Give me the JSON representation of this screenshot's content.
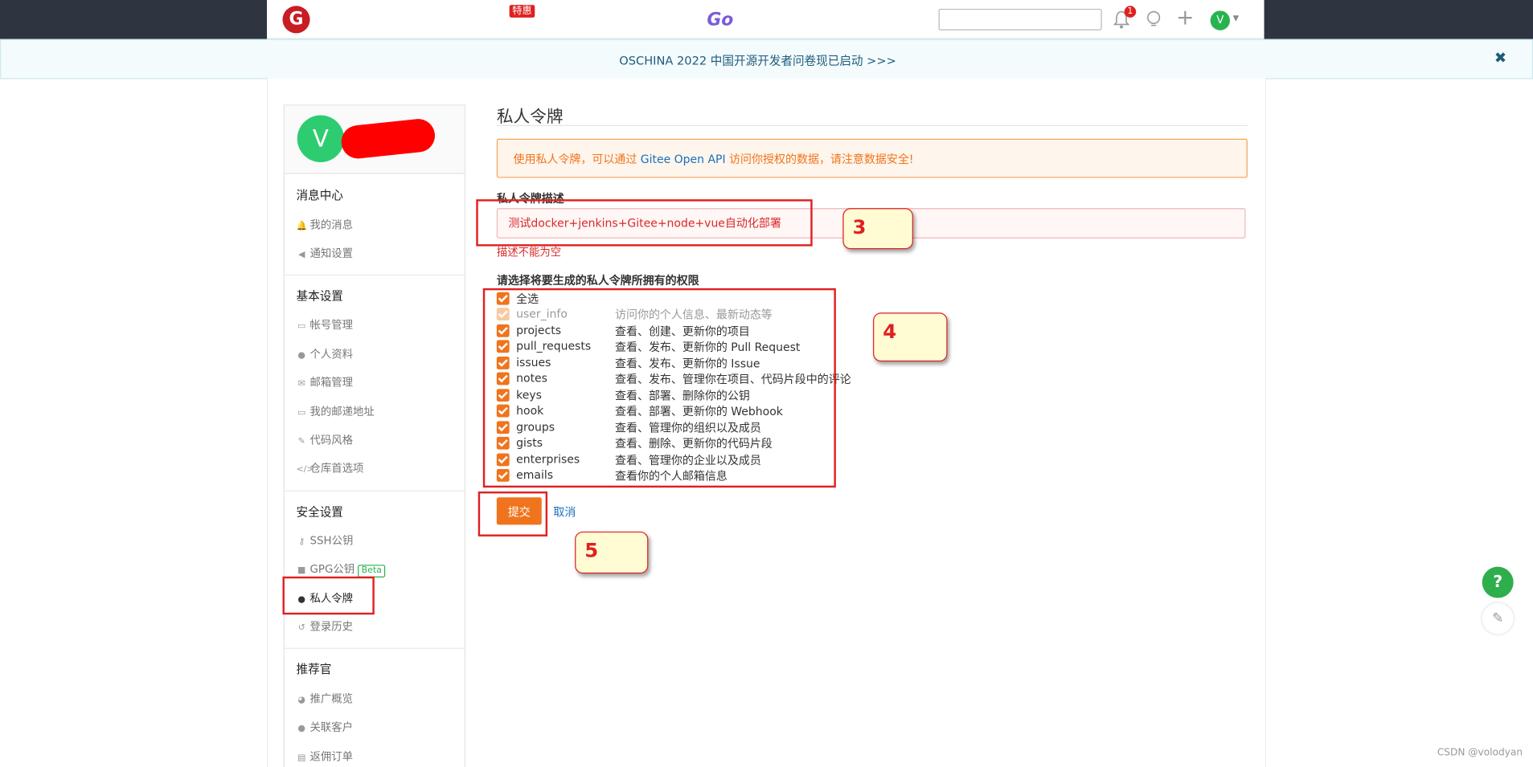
{
  "navbar": {
    "logo": "G",
    "promo_badge": "特惠",
    "go_label": "Go",
    "notification_count": "1",
    "avatar_letter": "V"
  },
  "notice": {
    "text": "OSCHINA 2022 中国开源开发者问卷现已启动 >>>",
    "close": "✖"
  },
  "sidebar": {
    "avatar_letter": "V",
    "groups": [
      {
        "title": "消息中心",
        "items": [
          {
            "icon": "bell-icon",
            "label": "我的消息"
          },
          {
            "icon": "speaker-icon",
            "label": "通知设置"
          }
        ]
      },
      {
        "title": "基本设置",
        "items": [
          {
            "icon": "idcard-icon",
            "label": "帐号管理"
          },
          {
            "icon": "user-icon",
            "label": "个人资料"
          },
          {
            "icon": "mail-icon",
            "label": "邮箱管理"
          },
          {
            "icon": "address-icon",
            "label": "我的邮递地址"
          },
          {
            "icon": "brush-icon",
            "label": "代码风格"
          },
          {
            "icon": "code-icon",
            "label": "仓库首选项"
          }
        ]
      },
      {
        "title": "安全设置",
        "items": [
          {
            "icon": "key-icon",
            "label": "SSH公钥"
          },
          {
            "icon": "lock-icon",
            "label": "GPG公钥",
            "badge": "Beta"
          },
          {
            "icon": "user-secret-icon",
            "label": "私人令牌",
            "active": true
          },
          {
            "icon": "history-icon",
            "label": "登录历史"
          }
        ]
      },
      {
        "title": "推荐官",
        "items": [
          {
            "icon": "chart-icon",
            "label": "推广概览"
          },
          {
            "icon": "users-icon",
            "label": "关联客户"
          },
          {
            "icon": "order-icon",
            "label": "返佣订单"
          }
        ]
      }
    ]
  },
  "main": {
    "title": "私人令牌",
    "alert": {
      "prefix": "使用私人令牌，可以通过 ",
      "link": "Gitee Open API",
      "suffix": " 访问你授权的数据，请注意数据安全!"
    },
    "description_label": "私人令牌描述",
    "description_value": "测试docker+jenkins+Gitee+node+vue自动化部署",
    "description_error": "描述不能为空",
    "permissions_label": "请选择将要生成的私人令牌所拥有的权限",
    "select_all": "全选",
    "permissions": [
      {
        "name": "user_info",
        "desc": "访问你的个人信息、最新动态等",
        "disabled": true
      },
      {
        "name": "projects",
        "desc": "查看、创建、更新你的项目"
      },
      {
        "name": "pull_requests",
        "desc": "查看、发布、更新你的 Pull Request"
      },
      {
        "name": "issues",
        "desc": "查看、发布、更新你的 Issue"
      },
      {
        "name": "notes",
        "desc": "查看、发布、管理你在项目、代码片段中的评论"
      },
      {
        "name": "keys",
        "desc": "查看、部署、删除你的公钥"
      },
      {
        "name": "hook",
        "desc": "查看、部署、更新你的 Webhook"
      },
      {
        "name": "groups",
        "desc": "查看、管理你的组织以及成员"
      },
      {
        "name": "gists",
        "desc": "查看、删除、更新你的代码片段"
      },
      {
        "name": "enterprises",
        "desc": "查看、管理你的企业以及成员"
      },
      {
        "name": "emails",
        "desc": "查看你的个人邮箱信息"
      }
    ],
    "submit_label": "提交",
    "cancel_label": "取消"
  },
  "annotations": {
    "step3": "3",
    "step4": "4",
    "step5": "5"
  },
  "help_button": "?",
  "watermark": "CSDN @volodyan"
}
